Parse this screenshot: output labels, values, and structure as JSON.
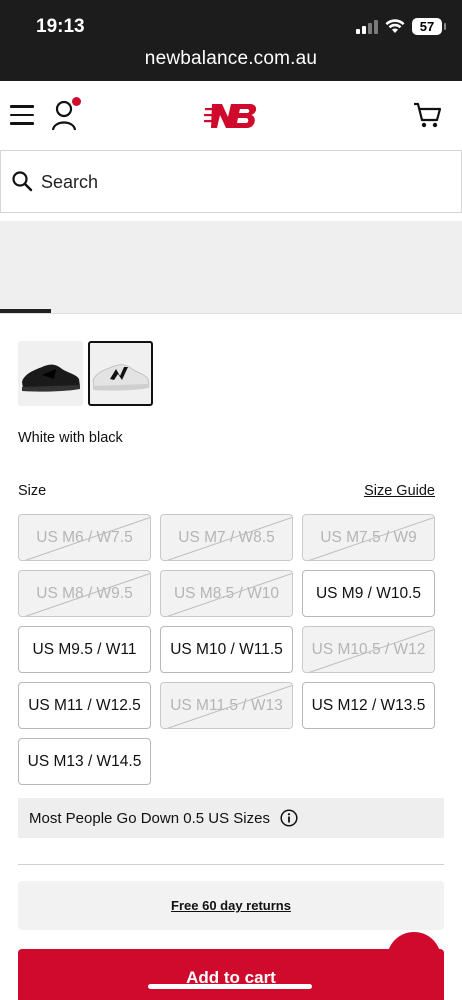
{
  "status_bar": {
    "time": "19:13",
    "battery": "57",
    "url": "newbalance.com.au"
  },
  "header": {
    "icons": [
      "menu-icon",
      "account-icon",
      "new-balance-logo",
      "cart-icon"
    ],
    "brand_color": "#cf0a2c"
  },
  "search": {
    "placeholder": "Search"
  },
  "product": {
    "color_name": "White with black",
    "size_label": "Size",
    "size_guide": "Size Guide",
    "sizes": [
      {
        "label": "US M6 / W7.5",
        "available": false
      },
      {
        "label": "US M7 / W8.5",
        "available": false
      },
      {
        "label": "US M7.5 / W9",
        "available": false
      },
      {
        "label": "US M8 / W9.5",
        "available": false
      },
      {
        "label": "US M8.5 / W10",
        "available": false
      },
      {
        "label": "US M9 / W10.5",
        "available": true
      },
      {
        "label": "US M9.5 / W11",
        "available": true
      },
      {
        "label": "US M10 / W11.5",
        "available": true
      },
      {
        "label": "US M10.5 / W12",
        "available": false
      },
      {
        "label": "US M11 / W12.5",
        "available": true
      },
      {
        "label": "US M11.5 / W13",
        "available": false
      },
      {
        "label": "US M12 / W13.5",
        "available": true
      },
      {
        "label": "US M13 / W14.5",
        "available": true
      }
    ],
    "fit_note": "Most People Go Down 0.5 US Sizes",
    "returns": "Free 60 day returns",
    "add_to_cart": "Add to cart"
  }
}
